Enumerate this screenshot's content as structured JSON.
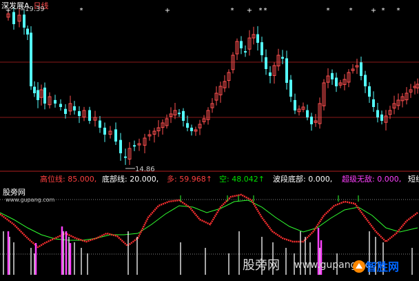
{
  "header": {
    "stock_name": "深发展A",
    "period": "日线"
  },
  "price_labels": {
    "high": "19.39",
    "low": "14.86"
  },
  "indicator_bar": {
    "items": [
      {
        "label": "高位线",
        "sep": ":",
        "value": "85.000,",
        "color": "#ff4040",
        "value_color": "#ff4040"
      },
      {
        "label": "底部线",
        "sep": ":",
        "value": "20.000,",
        "color": "#ffffff",
        "value_color": "#ffffff"
      },
      {
        "label": "多",
        "sep": ":",
        "value": "59.968↑",
        "color": "#ff4040",
        "value_color": "#ff4040"
      },
      {
        "label": "空",
        "sep": ":",
        "value": "48.042↑",
        "color": "#00e000",
        "value_color": "#00e000"
      },
      {
        "label": "波段底部",
        "sep": ":",
        "value": "0.000,",
        "color": "#ffffff",
        "value_color": "#ffffff"
      },
      {
        "label": "超级无敌",
        "sep": ":",
        "value": "0.000,",
        "color": "#ff40ff",
        "value_color": "#ff40ff"
      },
      {
        "label": "短线",
        "sep": "",
        "value": "",
        "color": "#ffffff",
        "value_color": "#ffffff"
      }
    ]
  },
  "sub_chart": {
    "name": "股旁网",
    "site": "www.gupang.com"
  },
  "watermark": {
    "text1": "股旁网",
    "text2": "www.gupang.com",
    "text3": "智胜网"
  },
  "colors": {
    "up": "#ff5050",
    "down": "#54fcfc",
    "signal": "#ffffff",
    "fast_line": "#ff3030",
    "slow_line": "#30ff30",
    "magenta": "#ff40ff"
  },
  "chart_data": {
    "type": "candlestick",
    "title": "深发展A 日线",
    "price_high": 19.39,
    "price_low": 14.86,
    "indicator_levels": {
      "high": 85,
      "low": 20
    },
    "current_values": {
      "fast": 59.968,
      "slow": 48.042
    }
  }
}
